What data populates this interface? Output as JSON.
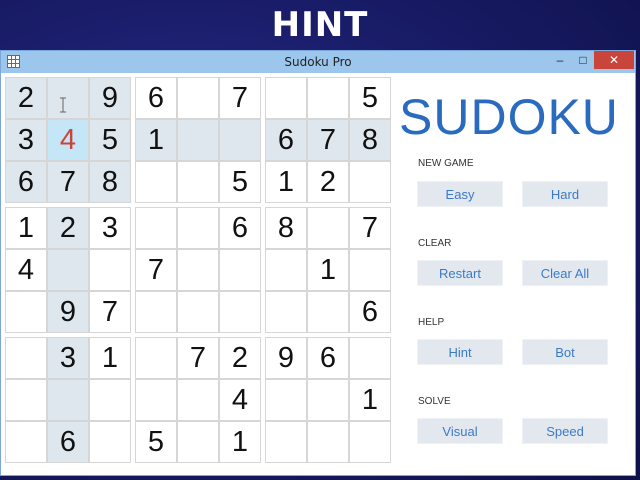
{
  "banner": {
    "text": "HINT"
  },
  "window": {
    "title": "Sudoku Pro",
    "minimize_glyph": "‒",
    "maximize_glyph": "□",
    "close_glyph": "✕",
    "app_icon": "grid-icon"
  },
  "board": {
    "rows": [
      [
        "2",
        "",
        "9",
        "6",
        "",
        "7",
        "",
        "",
        "5"
      ],
      [
        "3",
        "4",
        "5",
        "1",
        "",
        "",
        "6",
        "7",
        "8"
      ],
      [
        "6",
        "7",
        "8",
        "",
        "",
        "5",
        "1",
        "2",
        ""
      ],
      [
        "1",
        "2",
        "3",
        "",
        "",
        "6",
        "8",
        "",
        "7"
      ],
      [
        "4",
        "",
        "",
        "7",
        "",
        "",
        "",
        "1",
        ""
      ],
      [
        "",
        "9",
        "7",
        "",
        "",
        "",
        "",
        "",
        "6"
      ],
      [
        "",
        "3",
        "1",
        "",
        "7",
        "2",
        "9",
        "6",
        ""
      ],
      [
        "",
        "",
        "",
        "",
        "",
        "4",
        "",
        "",
        "1"
      ],
      [
        "",
        "6",
        "",
        "5",
        "",
        "1",
        "",
        "",
        ""
      ]
    ],
    "selected_cell": {
      "row": 1,
      "col": 1
    },
    "selected_value_color": "#c8453c",
    "highlight_color": "#dee6ee",
    "selected_bg_color": "#c4e6f6"
  },
  "side": {
    "title": "SUDOKU",
    "new_game_label": "NEW GAME",
    "easy_label": "Easy",
    "hard_label": "Hard",
    "clear_label": "CLEAR",
    "restart_label": "Restart",
    "clear_all_label": "Clear All",
    "help_label": "HELP",
    "hint_label": "Hint",
    "bot_label": "Bot",
    "solve_label": "SOLVE",
    "visual_label": "Visual",
    "speed_label": "Speed"
  },
  "colors": {
    "accent": "#2a6bbf",
    "button_text": "#3a7bc8",
    "titlebar": "#9cc6ec",
    "close": "#c9443b"
  }
}
